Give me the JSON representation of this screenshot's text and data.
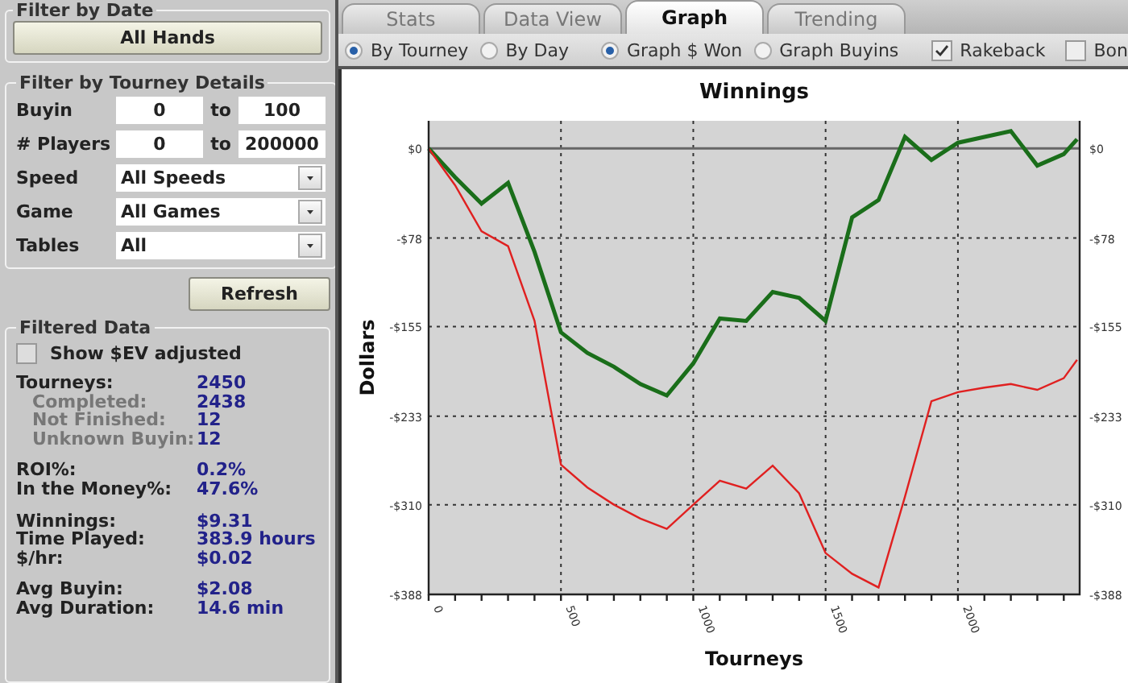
{
  "filter_by_date": {
    "title": "Filter by Date",
    "button": "All Hands"
  },
  "tourney_filter": {
    "title": "Filter by Tourney Details",
    "ranges": [
      {
        "label": "Buyin",
        "from": "0",
        "separator": "to",
        "to": "100"
      },
      {
        "label": "# Players",
        "from": "0",
        "separator": "to",
        "to": "200000"
      }
    ],
    "dropdowns": [
      {
        "label": "Speed",
        "value": "All Speeds"
      },
      {
        "label": "Game",
        "value": "All Games"
      },
      {
        "label": "Tables",
        "value": "All"
      }
    ]
  },
  "refresh_button": "Refresh",
  "filtered_data": {
    "title": "Filtered Data",
    "ev_checkbox": {
      "label": "Show $EV adjusted",
      "checked": false
    },
    "stat_groups": [
      [
        {
          "label": "Tourneys:",
          "value": "2450",
          "kind": "main"
        },
        {
          "label": "Completed:",
          "value": "2438",
          "kind": "sub"
        },
        {
          "label": "Not Finished:",
          "value": "12",
          "kind": "sub"
        },
        {
          "label": "Unknown Buyin:",
          "value": "12",
          "kind": "sub"
        }
      ],
      [
        {
          "label": "ROI%:",
          "value": "0.2%",
          "kind": "main"
        },
        {
          "label": "In the Money%:",
          "value": "47.6%",
          "kind": "main"
        }
      ],
      [
        {
          "label": "Winnings:",
          "value": "$9.31",
          "kind": "main"
        },
        {
          "label": "Time Played:",
          "value": "383.9 hours",
          "kind": "main"
        },
        {
          "label": "$/hr:",
          "value": "$0.02",
          "kind": "main"
        }
      ],
      [
        {
          "label": "Avg Buyin:",
          "value": "$2.08",
          "kind": "main"
        },
        {
          "label": "Avg Duration:",
          "value": "14.6 min",
          "kind": "main"
        }
      ]
    ]
  },
  "tabs": [
    {
      "label": "Stats",
      "selected": false
    },
    {
      "label": "Data View",
      "selected": false
    },
    {
      "label": "Graph",
      "selected": true
    },
    {
      "label": "Trending",
      "selected": false
    }
  ],
  "view_by": [
    {
      "label": "By Tourney",
      "selected": true
    },
    {
      "label": "By Day",
      "selected": false
    }
  ],
  "graph_type": [
    {
      "label": "Graph $ Won",
      "selected": true
    },
    {
      "label": "Graph Buyins",
      "selected": false
    }
  ],
  "toggles": [
    {
      "label": "Rakeback",
      "checked": true
    },
    {
      "label": "Bon",
      "checked": false
    }
  ],
  "chart_data": {
    "type": "line",
    "title": "Winnings",
    "xlabel": "Tourneys",
    "ylabel": "Dollars",
    "x": [
      0,
      100,
      200,
      300,
      400,
      500,
      600,
      700,
      800,
      900,
      1000,
      1100,
      1200,
      1300,
      1400,
      1500,
      1600,
      1700,
      1800,
      1900,
      2000,
      2100,
      2200,
      2300,
      2400,
      2450
    ],
    "series": [
      {
        "color": "#1a6e1a",
        "values": [
          0,
          -25,
          -48,
          -30,
          -90,
          -160,
          -178,
          -190,
          -205,
          -215,
          -187,
          -148,
          -150,
          -125,
          -130,
          -150,
          -60,
          -45,
          10,
          -10,
          5,
          10,
          15,
          -15,
          -5,
          8
        ]
      },
      {
        "color": "#e02020",
        "values": [
          0,
          -32,
          -72,
          -85,
          -150,
          -275,
          -295,
          -310,
          -322,
          -331,
          -310,
          -289,
          -296,
          -276,
          -300,
          -352,
          -370,
          -382,
          -303,
          -220,
          -212,
          -208,
          -205,
          -210,
          -200,
          -184
        ]
      }
    ],
    "grid": true,
    "xlim": [
      0,
      2460
    ],
    "ylim": [
      -388,
      24
    ],
    "xticks": [
      0,
      500,
      1000,
      1500,
      2000
    ],
    "yticks": [
      {
        "value": 0,
        "label": "$0"
      },
      {
        "value": -78,
        "label": "-$78"
      },
      {
        "value": -155,
        "label": "-$155"
      },
      {
        "value": -233,
        "label": "-$233"
      },
      {
        "value": -310,
        "label": "-$310"
      },
      {
        "value": -388,
        "label": "-$388"
      }
    ]
  }
}
